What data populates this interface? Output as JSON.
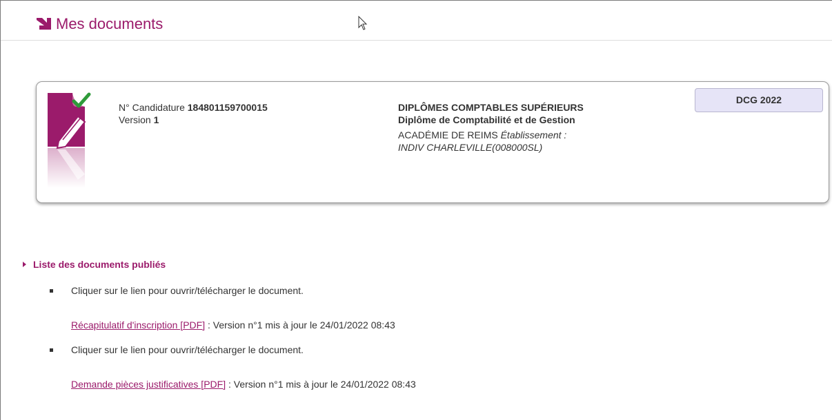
{
  "header": {
    "title": "Mes documents",
    "brand_color": "#9b1b6b"
  },
  "candidature": {
    "numero_label": "N° Candidature",
    "numero_value": "184801159700015",
    "version_label": "Version",
    "version_value": "1"
  },
  "diplome": {
    "category": "DIPLÔMES COMPTABLES SUPÉRIEURS",
    "name": "Diplôme de Comptabilité et de Gestion",
    "academie": "ACADÉMIE DE REIMS",
    "etablissement_label": "Établissement :",
    "etablissement_value": "INDIV CHARLEVILLE(008000SL)"
  },
  "badge": {
    "label": "DCG 2022",
    "bg_color": "#e6e4f7"
  },
  "section": {
    "title": "Liste des documents publiés"
  },
  "documents": [
    {
      "instruction": "Cliquer sur le lien pour ouvrir/télécharger le document.",
      "link_text": "Récapitulatif d'inscription [PDF]",
      "info": " : Version n°1 mis à jour le 24/01/2022 08:43"
    },
    {
      "instruction": "Cliquer sur le lien pour ouvrir/télécharger le document.",
      "link_text": "Demande pièces justificatives [PDF]",
      "info": " : Version n°1 mis à jour le 24/01/2022 08:43"
    }
  ],
  "icons": {
    "logo": "brand-arrow-icon",
    "document": "document-edit-check-icon",
    "cursor": "mouse-pointer-icon"
  }
}
